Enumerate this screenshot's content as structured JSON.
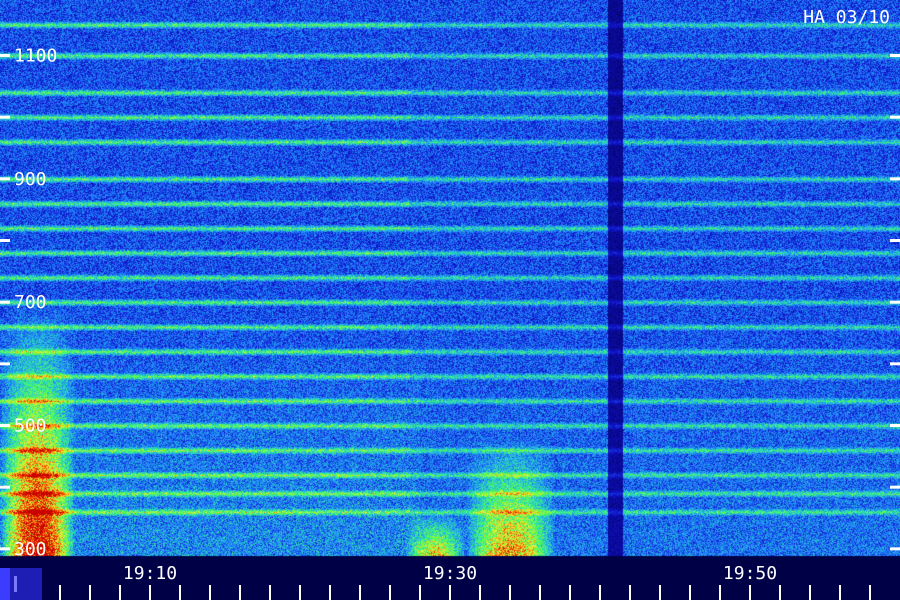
{
  "chart_data": {
    "type": "heatmap",
    "title": "",
    "station_label": "HA 03/10",
    "xlabel": "",
    "ylabel": "",
    "x_ticks": [
      {
        "value": "19:10",
        "minutes": 10
      },
      {
        "value": "19:30",
        "minutes": 30
      },
      {
        "value": "19:50",
        "minutes": 50
      }
    ],
    "x_minor_every_minutes": 2,
    "xlim_minutes": [
      0,
      60
    ],
    "y_ticks": [
      300,
      500,
      700,
      900,
      1100
    ],
    "y_minor_every": 100,
    "ylim": [
      290,
      1190
    ],
    "grid": false,
    "colormap": [
      "#000046",
      "#1010c8",
      "#1e78ff",
      "#28d2c8",
      "#50ff50",
      "#f0f032",
      "#ff5a00",
      "#c80000"
    ],
    "harmonic_bands": [
      360,
      390,
      420,
      460,
      500,
      540,
      580,
      620,
      660,
      700,
      740,
      780,
      820,
      860,
      900,
      960,
      1000,
      1040,
      1100,
      1150
    ],
    "bursts": [
      {
        "minute_start": 0,
        "minute_end": 5,
        "freq_min": 290,
        "freq_max": 700,
        "intensity": 0.95
      },
      {
        "minute_start": 27,
        "minute_end": 31,
        "freq_min": 290,
        "freq_max": 360,
        "intensity": 0.6
      },
      {
        "minute_start": 31,
        "minute_end": 37,
        "freq_min": 290,
        "freq_max": 480,
        "intensity": 0.7
      }
    ],
    "gap_minutes": [
      40.5,
      41.5
    ]
  }
}
